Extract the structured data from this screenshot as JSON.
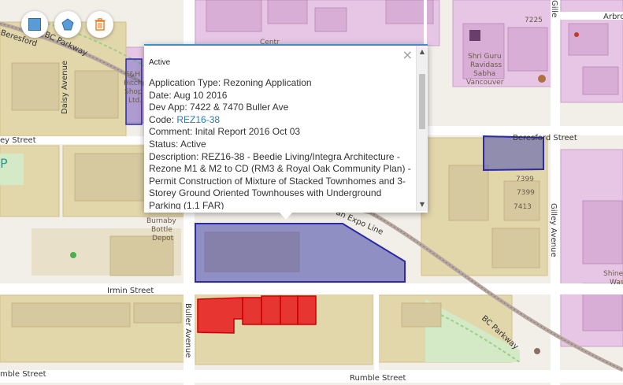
{
  "map": {
    "streets": {
      "beresford_tl": "Beresford",
      "bc_parkway_top": "BC Parkway",
      "daisy_avenue": "Daisy Avenue",
      "ey_street": "ey Street",
      "beresford_street": "Beresford Street",
      "gilley_avenue": "Gilley Avenue",
      "gille_top": "Gille",
      "arbor": "Arbro",
      "irmin_street": "Irmin Street",
      "buller_avenue": "Buller Avenue",
      "bc_parkway_bottom": "BC Parkway",
      "rumble_street_center": "Rumble Street",
      "rumble_street_left": "mble Street",
      "expo_line": "an Expo Line"
    },
    "places": {
      "temple_line1": "Shri Guru",
      "temple_line2": "Ravidass",
      "temple_line3": "Sabha",
      "temple_line4": "Vancouver",
      "fh_line1": "F&H",
      "fh_line2": "Hitch",
      "fh_line3": "Shop",
      "fh_line4": "Ltd.",
      "depot_line1": "Burnaby",
      "depot_line2": "Bottle",
      "depot_line3": "Depot",
      "shine_line1": "Shine",
      "shine_line2": "Was",
      "partial_p": "P",
      "centre": "Centr"
    },
    "house_numbers": [
      "7225",
      "7399",
      "7399",
      "7413"
    ]
  },
  "toolbar": {
    "rectangle_tool": "rectangle-draw",
    "polygon_tool": "polygon-draw",
    "delete_tool": "delete"
  },
  "popup": {
    "title": "Active",
    "application_type_label": "Application Type: Rezoning Application",
    "date_label": "Date: Aug 10 2016",
    "dev_app_label": "Dev App: 7422 & 7470 Buller Ave",
    "code_prefix": "Code: ",
    "code_link": "REZ16-38",
    "comment_label": "Comment: Inital Report 2016 Oct 03",
    "status_label": "Status: Active",
    "description_lines": [
      "Description: REZ16-38 - Beedie Living/Integra Architecture -",
      "Rezone M1 & M2 to CD (RM3 & Royal Oak Community Plan) -",
      "Permit Construction of Mixture of Stacked Townhomes and 3-",
      "Storey Ground Oriented Townhouses with Underground",
      "Parking (1.1 FAR)"
    ],
    "close_glyph": "×",
    "scroll_up_glyph": "▲",
    "scroll_down_glyph": "▼"
  },
  "colors": {
    "active_polygon": "#5b5bb0",
    "selected_parcel": "#e8191b",
    "industrial": "#e0d3a8",
    "commercial": "#e8c6e6",
    "park": "#cfe9c4",
    "link": "#2a7ab5"
  }
}
